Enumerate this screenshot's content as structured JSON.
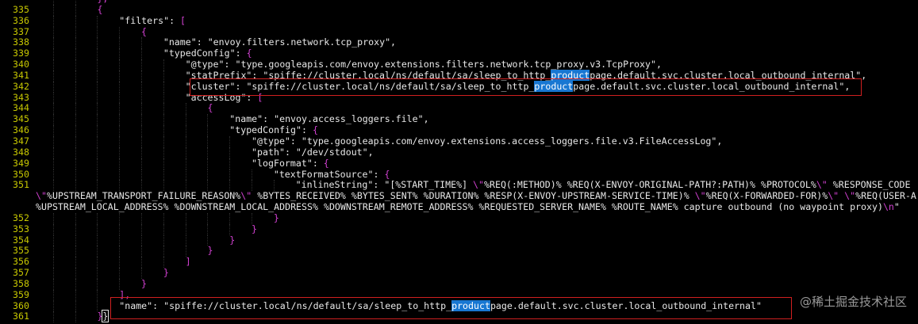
{
  "editor": {
    "highlight_term": "product",
    "lines": [
      {
        "n": "",
        "indent": 11,
        "tokens": [
          [
            "punc",
            "},"
          ]
        ]
      },
      {
        "n": "335",
        "indent": 11,
        "tokens": [
          [
            "punc",
            "{"
          ]
        ]
      },
      {
        "n": "336",
        "indent": 15,
        "tokens": [
          [
            "key",
            "\"filters\""
          ],
          [
            "plain",
            ": "
          ],
          [
            "punc",
            "["
          ]
        ]
      },
      {
        "n": "337",
        "indent": 19,
        "tokens": [
          [
            "punc",
            "{"
          ]
        ]
      },
      {
        "n": "338",
        "indent": 23,
        "tokens": [
          [
            "key",
            "\"name\""
          ],
          [
            "plain",
            ": "
          ],
          [
            "str",
            "\"envoy.filters.network.tcp_proxy\""
          ],
          [
            "plain",
            ","
          ]
        ]
      },
      {
        "n": "339",
        "indent": 23,
        "tokens": [
          [
            "key",
            "\"typedConfig\""
          ],
          [
            "plain",
            ": "
          ],
          [
            "punc",
            "{"
          ]
        ]
      },
      {
        "n": "340",
        "indent": 27,
        "tokens": [
          [
            "key",
            "\"@type\""
          ],
          [
            "plain",
            ": "
          ],
          [
            "str",
            "\"type.googleapis.com/envoy.extensions.filters.network.tcp_proxy.v3.TcpProxy\""
          ],
          [
            "plain",
            ","
          ]
        ]
      },
      {
        "n": "341",
        "indent": 27,
        "tokens": [
          [
            "key",
            "\"statPrefix\""
          ],
          [
            "plain",
            ": "
          ],
          [
            "str",
            "\"spiffe://cluster.local/ns/default/sa/sleep_to_http_"
          ],
          [
            "hl",
            "product"
          ],
          [
            "str",
            "page.default.svc.cluster.local_outbound_internal\""
          ],
          [
            "plain",
            ","
          ]
        ]
      },
      {
        "n": "342",
        "indent": 27,
        "tokens": [
          [
            "key",
            "\"cluster\""
          ],
          [
            "plain",
            ": "
          ],
          [
            "str",
            "\"spiffe://cluster.local/ns/default/sa/sleep_to_http_"
          ],
          [
            "hl",
            "product"
          ],
          [
            "str",
            "page.default.svc.cluster.local_outbound_internal\""
          ],
          [
            "plain",
            ","
          ]
        ]
      },
      {
        "n": "343",
        "indent": 27,
        "tokens": [
          [
            "key",
            "\"accessLog\""
          ],
          [
            "plain",
            ": "
          ],
          [
            "punc",
            "["
          ]
        ]
      },
      {
        "n": "344",
        "indent": 31,
        "tokens": [
          [
            "punc",
            "{"
          ]
        ]
      },
      {
        "n": "345",
        "indent": 35,
        "tokens": [
          [
            "key",
            "\"name\""
          ],
          [
            "plain",
            ": "
          ],
          [
            "str",
            "\"envoy.access_loggers.file\""
          ],
          [
            "plain",
            ","
          ]
        ]
      },
      {
        "n": "346",
        "indent": 35,
        "tokens": [
          [
            "key",
            "\"typedConfig\""
          ],
          [
            "plain",
            ": "
          ],
          [
            "punc",
            "{"
          ]
        ]
      },
      {
        "n": "347",
        "indent": 39,
        "tokens": [
          [
            "key",
            "\"@type\""
          ],
          [
            "plain",
            ": "
          ],
          [
            "str",
            "\"type.googleapis.com/envoy.extensions.access_loggers.file.v3.FileAccessLog\""
          ],
          [
            "plain",
            ","
          ]
        ]
      },
      {
        "n": "348",
        "indent": 39,
        "tokens": [
          [
            "key",
            "\"path\""
          ],
          [
            "plain",
            ": "
          ],
          [
            "str",
            "\"/dev/stdout\""
          ],
          [
            "plain",
            ","
          ]
        ]
      },
      {
        "n": "349",
        "indent": 39,
        "tokens": [
          [
            "key",
            "\"logFormat\""
          ],
          [
            "plain",
            ": "
          ],
          [
            "punc",
            "{"
          ]
        ]
      },
      {
        "n": "350",
        "indent": 43,
        "tokens": [
          [
            "key",
            "\"textFormatSource\""
          ],
          [
            "plain",
            ": "
          ],
          [
            "punc",
            "{"
          ]
        ]
      },
      {
        "n": "351",
        "indent": 47,
        "tokens": [
          [
            "key",
            "\"inlineString\""
          ],
          [
            "plain",
            ": "
          ],
          [
            "str",
            "\"[%START_TIME%] "
          ],
          [
            "esc",
            "\\\""
          ],
          [
            "str",
            "%REQ(:METHOD)% %REQ(X-ENVOY-ORIGINAL-PATH?:PATH)% %PROTOCOL%"
          ],
          [
            "esc",
            "\\\""
          ],
          [
            "str",
            " %RESPONSE_CODE"
          ]
        ]
      },
      {
        "n": "",
        "cont": true,
        "indent": 0,
        "tokens": [
          [
            "esc",
            "\\\""
          ],
          [
            "str",
            "%UPSTREAM_TRANSPORT_FAILURE_REASON%"
          ],
          [
            "esc",
            "\\\""
          ],
          [
            "str",
            " %BYTES_RECEIVED% %BYTES_SENT% %DURATION% %RESP(X-ENVOY-UPSTREAM-SERVICE-TIME)% "
          ],
          [
            "esc",
            "\\\""
          ],
          [
            "str",
            "%REQ(X-FORWARDED-FOR)%"
          ],
          [
            "esc",
            "\\\""
          ],
          [
            "str",
            " "
          ],
          [
            "esc",
            "\\\""
          ],
          [
            "str",
            "%REQ(USER-A"
          ]
        ]
      },
      {
        "n": "",
        "cont": true,
        "indent": 0,
        "tokens": [
          [
            "str",
            "%UPSTREAM_LOCAL_ADDRESS% %DOWNSTREAM_LOCAL_ADDRESS% %DOWNSTREAM_REMOTE_ADDRESS% %REQUESTED_SERVER_NAME% %ROUTE_NAME% capture outbound (no waypoint proxy)"
          ],
          [
            "esc",
            "\\n"
          ],
          [
            "str",
            "\""
          ]
        ]
      },
      {
        "n": "352",
        "indent": 43,
        "tokens": [
          [
            "punc",
            "}"
          ]
        ]
      },
      {
        "n": "353",
        "indent": 39,
        "tokens": [
          [
            "punc",
            "}"
          ]
        ]
      },
      {
        "n": "354",
        "indent": 35,
        "tokens": [
          [
            "punc",
            "}"
          ]
        ]
      },
      {
        "n": "355",
        "indent": 31,
        "tokens": [
          [
            "punc",
            "}"
          ]
        ]
      },
      {
        "n": "356",
        "indent": 27,
        "tokens": [
          [
            "punc",
            "]"
          ]
        ]
      },
      {
        "n": "357",
        "indent": 23,
        "tokens": [
          [
            "punc",
            "}"
          ]
        ]
      },
      {
        "n": "358",
        "indent": 19,
        "tokens": [
          [
            "punc",
            "}"
          ]
        ]
      },
      {
        "n": "359",
        "indent": 15,
        "tokens": [
          [
            "punc",
            "],"
          ]
        ]
      },
      {
        "n": "360",
        "indent": 15,
        "tokens": [
          [
            "key",
            "\"name\""
          ],
          [
            "plain",
            ": "
          ],
          [
            "str",
            "\"spiffe://cluster.local/ns/default/sa/sleep_to_http_"
          ],
          [
            "hl",
            "product"
          ],
          [
            "str",
            "page.default.svc.cluster.local_outbound_internal\""
          ]
        ]
      },
      {
        "n": "361",
        "indent": 11,
        "tokens": [
          [
            "punc",
            "}"
          ],
          [
            "cursor",
            "}"
          ]
        ]
      }
    ]
  },
  "watermark": "@稀土掘金技术社区",
  "colors": {
    "background": "#000000",
    "line_number": "#c8c800",
    "bracket": "#d040d0",
    "text": "#e8e8e8",
    "search_highlight": "#1877d2",
    "annotation_box": "#d02020"
  }
}
